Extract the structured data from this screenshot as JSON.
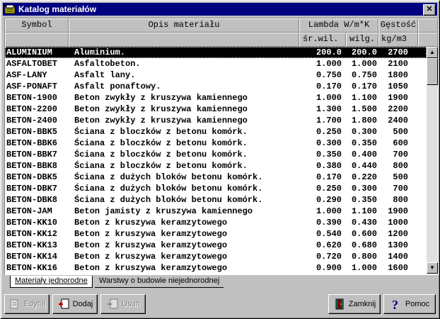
{
  "window": {
    "title": "Katalog materiałów",
    "close_glyph": "✕"
  },
  "headers": {
    "symbol": "Symbol",
    "opis": "Opis materiału",
    "lambda": "Lambda W/m*K",
    "lambda_sr": "śr.wil.",
    "lambda_wilg": "wilg.",
    "gestosc": "Gęstość",
    "gestosc_unit": "kg/m3"
  },
  "rows": [
    {
      "symbol": "ALUMINIUM",
      "opis": "Aluminium.",
      "l1": "200.0",
      "l2": "200.0",
      "g": "2700",
      "selected": true
    },
    {
      "symbol": "ASFALTOBET",
      "opis": "Asfaltobeton.",
      "l1": "1.000",
      "l2": "1.000",
      "g": "2100"
    },
    {
      "symbol": "ASF-LANY",
      "opis": "Asfalt lany.",
      "l1": "0.750",
      "l2": "0.750",
      "g": "1800"
    },
    {
      "symbol": "ASF-PONAFT",
      "opis": "Asfalt ponaftowy.",
      "l1": "0.170",
      "l2": "0.170",
      "g": "1050"
    },
    {
      "symbol": "BETON-1900",
      "opis": "Beton zwykły z kruszywa kamiennego",
      "l1": "1.000",
      "l2": "1.100",
      "g": "1900"
    },
    {
      "symbol": "BETON-2200",
      "opis": "Beton zwykły z kruszywa kamiennego",
      "l1": "1.300",
      "l2": "1.500",
      "g": "2200"
    },
    {
      "symbol": "BETON-2400",
      "opis": "Beton zwykły z kruszywa kamiennego",
      "l1": "1.700",
      "l2": "1.800",
      "g": "2400"
    },
    {
      "symbol": "BETON-BBK5",
      "opis": "Ściana z bloczków z betonu komórk.",
      "l1": "0.250",
      "l2": "0.300",
      "g": "500"
    },
    {
      "symbol": "BETON-BBK6",
      "opis": "Ściana z bloczków z betonu komórk.",
      "l1": "0.300",
      "l2": "0.350",
      "g": "600"
    },
    {
      "symbol": "BETON-BBK7",
      "opis": "Ściana z bloczków z betonu komórk.",
      "l1": "0.350",
      "l2": "0.400",
      "g": "700"
    },
    {
      "symbol": "BETON-BBK8",
      "opis": "Ściana z bloczków z betonu komórk.",
      "l1": "0.380",
      "l2": "0.440",
      "g": "800"
    },
    {
      "symbol": "BETON-DBK5",
      "opis": "Ściana z dużych bloków betonu komórk.",
      "l1": "0.170",
      "l2": "0.220",
      "g": "500"
    },
    {
      "symbol": "BETON-DBK7",
      "opis": "Ściana z dużych bloków betonu komórk.",
      "l1": "0.250",
      "l2": "0.300",
      "g": "700"
    },
    {
      "symbol": "BETON-DBK8",
      "opis": "Ściana z dużych bloków betonu komórk.",
      "l1": "0.290",
      "l2": "0.350",
      "g": "800"
    },
    {
      "symbol": "BETON-JAM",
      "opis": "Beton jamisty z kruszywa kamiennego",
      "l1": "1.000",
      "l2": "1.100",
      "g": "1900"
    },
    {
      "symbol": "BETON-KK10",
      "opis": "Beton z kruszywa keramzytowego",
      "l1": "0.390",
      "l2": "0.430",
      "g": "1000"
    },
    {
      "symbol": "BETON-KK12",
      "opis": "Beton z kruszywa keramzytowego",
      "l1": "0.540",
      "l2": "0.600",
      "g": "1200"
    },
    {
      "symbol": "BETON-KK13",
      "opis": "Beton z kruszywa keramzytowego",
      "l1": "0.620",
      "l2": "0.680",
      "g": "1300"
    },
    {
      "symbol": "BETON-KK14",
      "opis": "Beton z kruszywa keramzytowego",
      "l1": "0.720",
      "l2": "0.800",
      "g": "1400"
    },
    {
      "symbol": "BETON-KK16",
      "opis": "Beton z kruszywa keramzytowego",
      "l1": "0.900",
      "l2": "1.000",
      "g": "1600"
    }
  ],
  "tabs": [
    {
      "label": "Materiały jednorodne",
      "active": true
    },
    {
      "label": "Warstwy o budowie niejednorodnej",
      "active": false
    }
  ],
  "buttons": {
    "edit": "Edytuj",
    "add": "Dodaj",
    "delete": "Usuń",
    "close": "Zamknij",
    "help": "Pomoc"
  },
  "colors": {
    "titlebar": "#000080",
    "selection": "#000000"
  },
  "icons": {
    "app": "catalog-icon",
    "edit": "edit-icon",
    "add": "add-icon",
    "delete": "delete-icon",
    "close": "door-icon",
    "help": "help-question-icon"
  }
}
